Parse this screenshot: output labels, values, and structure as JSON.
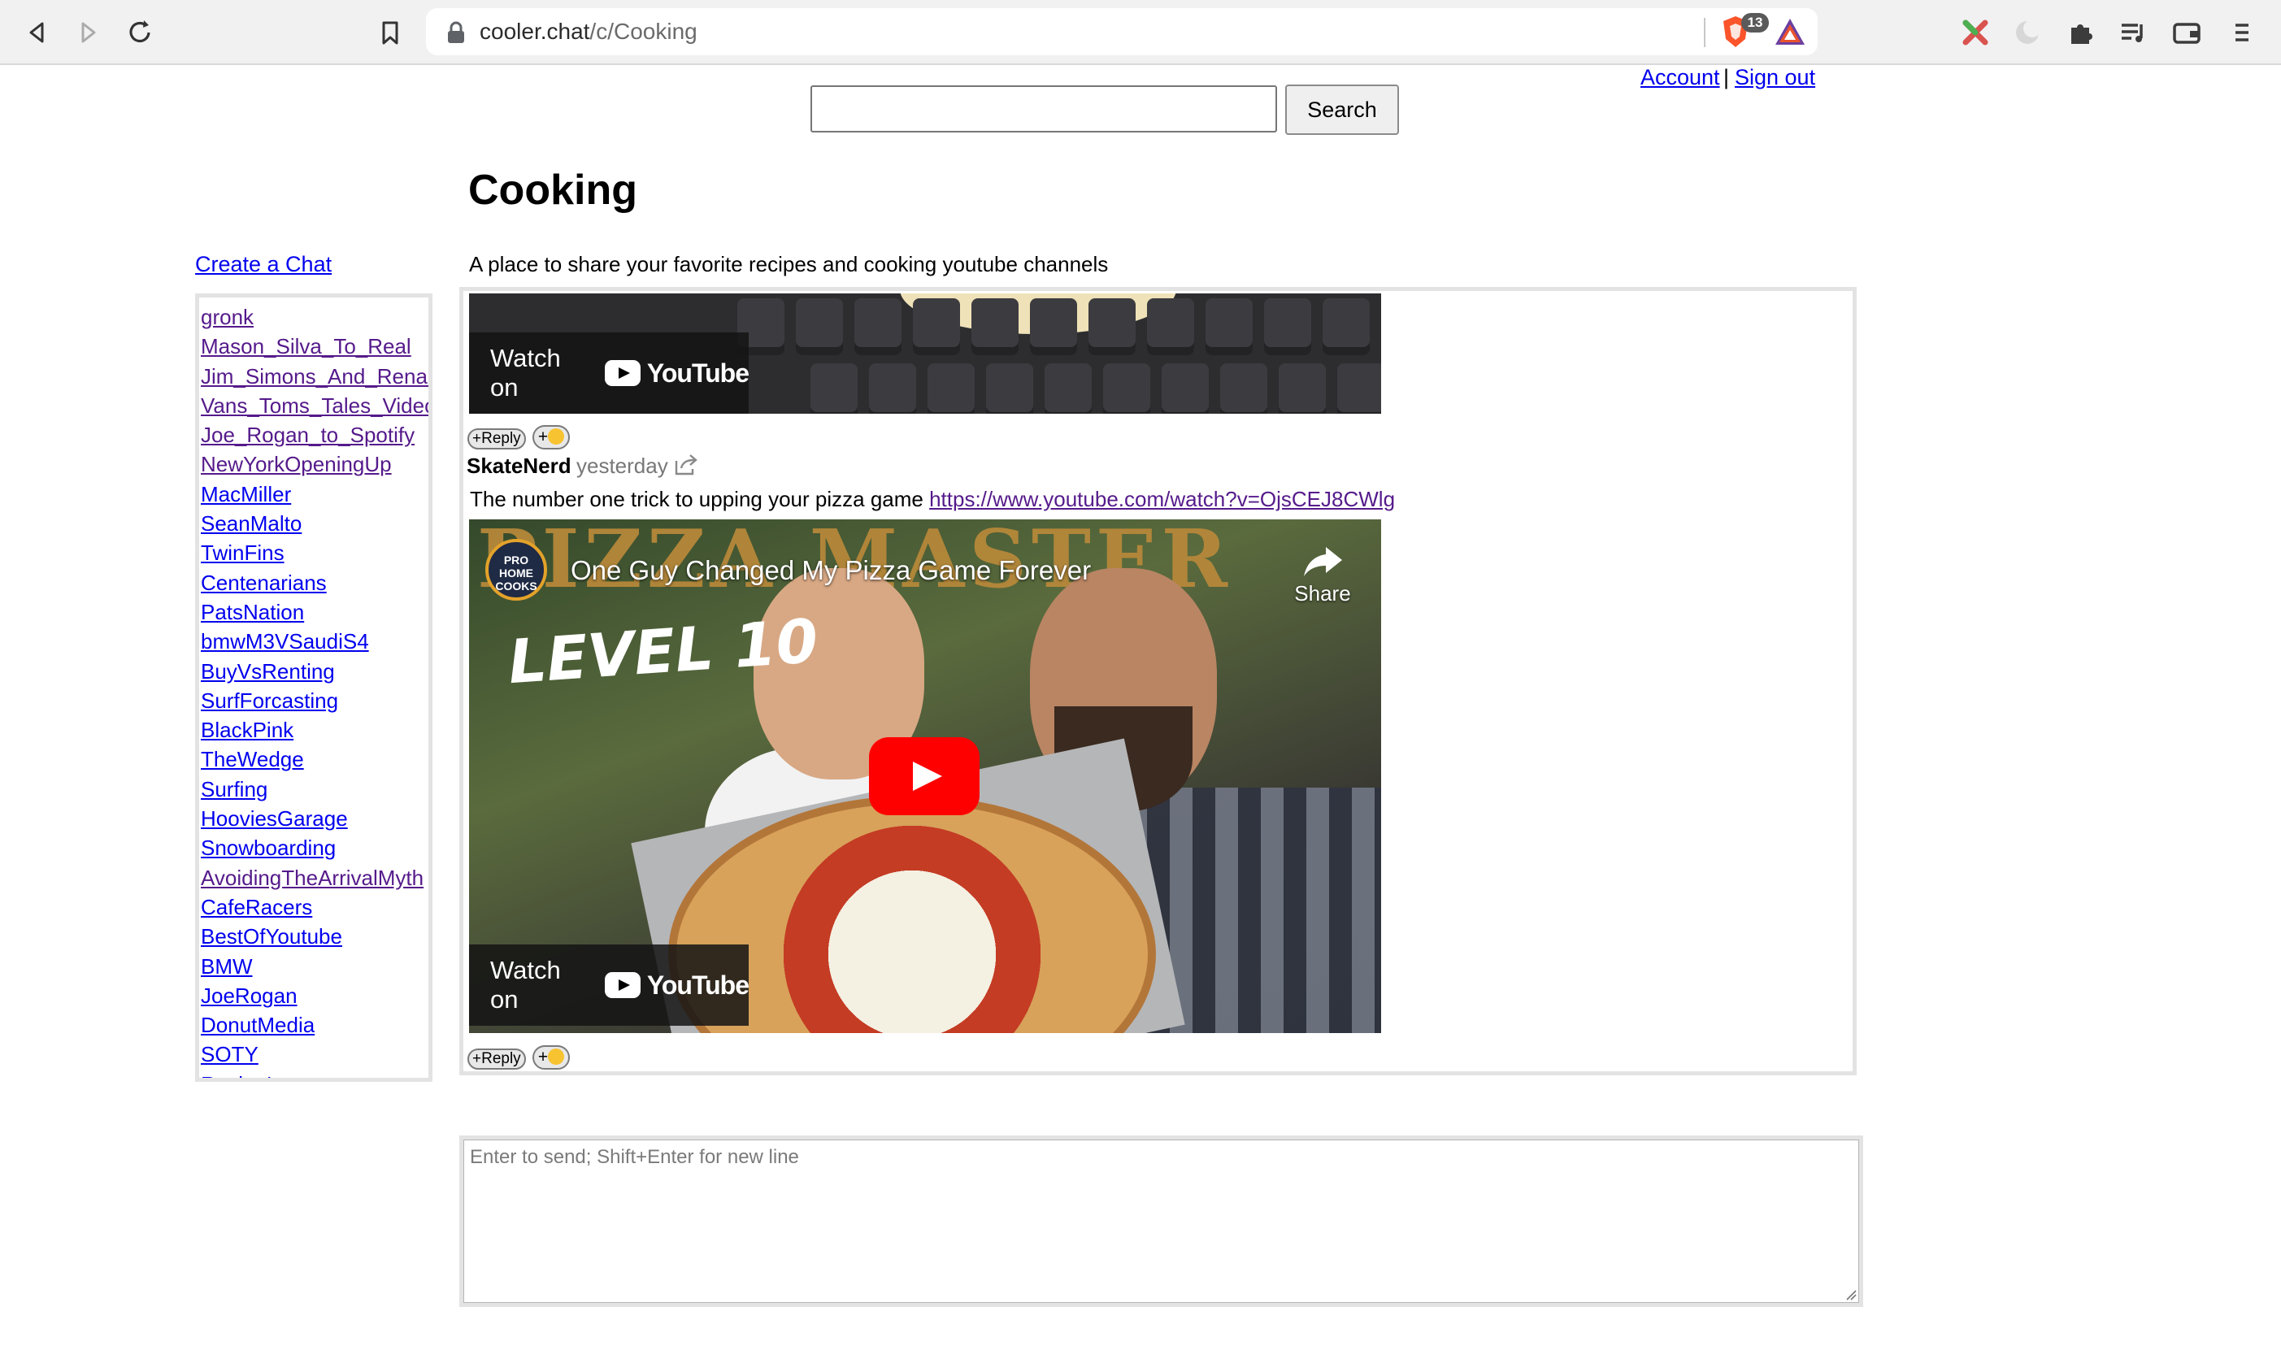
{
  "browser": {
    "url_host": "cooler.chat",
    "url_path": "/c/Cooking",
    "shields_count": "13"
  },
  "header": {
    "account_label": "Account ",
    "separator": "|",
    "signout_label": "Sign out",
    "search_placeholder": "",
    "search_button": "Search"
  },
  "chat": {
    "title": "Cooking",
    "description": "A place to share your favorite recipes and cooking youtube channels"
  },
  "sidebar": {
    "create_chat_label": "Create a Chat",
    "chats": [
      "gronk",
      "Mason_Silva_To_Real",
      "Jim_Simons_And_Renaissance",
      "Vans_Toms_Tales_Videos",
      "Joe_Rogan_to_Spotify",
      "NewYorkOpeningUp",
      "MacMiller",
      "SeanMalto",
      "TwinFins",
      "Centenarians",
      "PatsNation",
      "bmwM3VSaudiS4",
      "BuyVsRenting",
      "SurfForcasting",
      "BlackPink",
      "TheWedge",
      "Surfing",
      "HooviesGarage",
      "Snowboarding",
      "AvoidingTheArrivalMyth",
      "CafeRacers",
      "BestOfYoutube",
      "BMW",
      "JoeRogan",
      "DonutMedia",
      "SOTY",
      "RocketLeague"
    ]
  },
  "messages": {
    "embed_watch_on": "Watch on",
    "embed_youtube": "YouTube",
    "reply_label": "+Reply",
    "emoji_plus": "+",
    "post": {
      "author": "SkateNerd",
      "time": "yesterday",
      "text": "The number one trick to upping your pizza game ",
      "link": "https://www.youtube.com/watch?v=OjsCEJ8CWlg",
      "video": {
        "title": "One Guy Changed My Pizza Game Forever",
        "share_label": "Share",
        "thumb_brand_text": "PIZZA MASTER",
        "thumb_level_text": "LEVEL 10",
        "channel_badge": "PRO HOME COOKS"
      }
    }
  },
  "composer": {
    "placeholder": "Enter to send; Shift+Enter for new line"
  }
}
